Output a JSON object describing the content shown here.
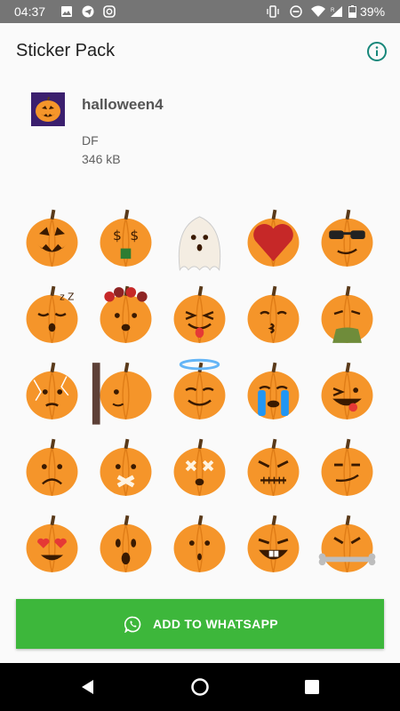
{
  "status_bar": {
    "time": "04:37",
    "battery": "39%",
    "left_icons": [
      "image-icon",
      "telegram-icon",
      "instagram-icon"
    ],
    "right_icons": [
      "vibrate-icon",
      "dnd-icon",
      "wifi-icon",
      "signal-icon",
      "battery-icon"
    ]
  },
  "app_bar": {
    "title": "Sticker Pack",
    "info_icon": "info-icon"
  },
  "pack": {
    "name": "halloween4",
    "publisher": "DF",
    "size": "346 kB"
  },
  "stickers": [
    "jack-o-lantern",
    "money-eyes",
    "ghost",
    "heart",
    "sunglasses",
    "sleeping",
    "flower-crown",
    "tongue-wink",
    "kiss",
    "sick-vomit",
    "cracked",
    "peeking-door",
    "angel-halo",
    "crying",
    "tongue-silly",
    "sad",
    "mouth-taped",
    "x-eyes-taped",
    "stitched-angry",
    "smirk",
    "heart-eyes",
    "surprised",
    "neutral",
    "buck-teeth-laugh",
    "bone-angry"
  ],
  "colors": {
    "pumpkin": "#f5952a",
    "accent": "#3db73b",
    "info": "#17877a"
  },
  "add_button": {
    "label": "ADD TO WHATSAPP",
    "icon": "whatsapp-icon"
  },
  "nav": {
    "back": "back-icon",
    "home": "home-icon",
    "recents": "recents-icon"
  }
}
